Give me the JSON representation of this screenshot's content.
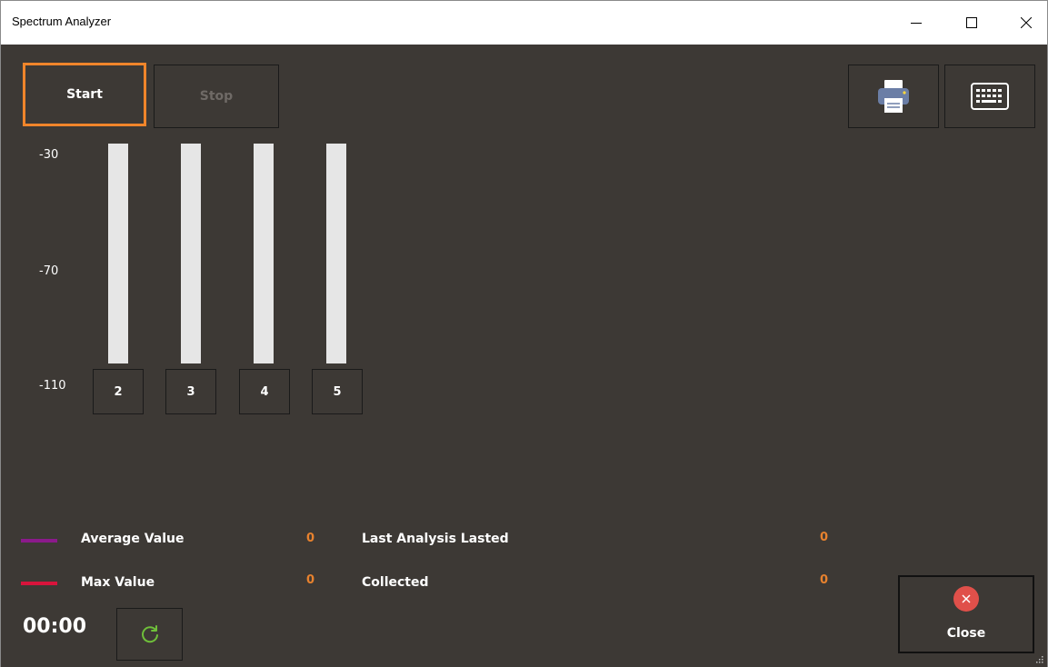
{
  "window": {
    "title": "Spectrum Analyzer"
  },
  "toolbar": {
    "start_label": "Start",
    "stop_label": "Stop",
    "print_icon": "printer-icon",
    "keyboard_icon": "keyboard-icon"
  },
  "axis": {
    "labels": [
      "-30",
      "-70",
      "-110"
    ]
  },
  "channels": [
    {
      "label": "2",
      "level": 0
    },
    {
      "label": "3",
      "level": 0
    },
    {
      "label": "4",
      "level": 0
    },
    {
      "label": "5",
      "level": 0
    }
  ],
  "legend": {
    "average_label": "Average Value",
    "average_value": "0",
    "average_color": "#8b1a8b",
    "max_label": "Max Value",
    "max_value": "0",
    "max_color": "#d8143c"
  },
  "stats": {
    "last_analysis_label": "Last Analysis Lasted",
    "last_analysis_value": "0",
    "collected_label": "Collected",
    "collected_value": "0"
  },
  "footer": {
    "timer": "00:00",
    "refresh_icon": "refresh-icon",
    "close_label": "Close",
    "close_icon": "close-circle-icon",
    "accent": "#f0852b",
    "value_color": "#e8822e"
  }
}
